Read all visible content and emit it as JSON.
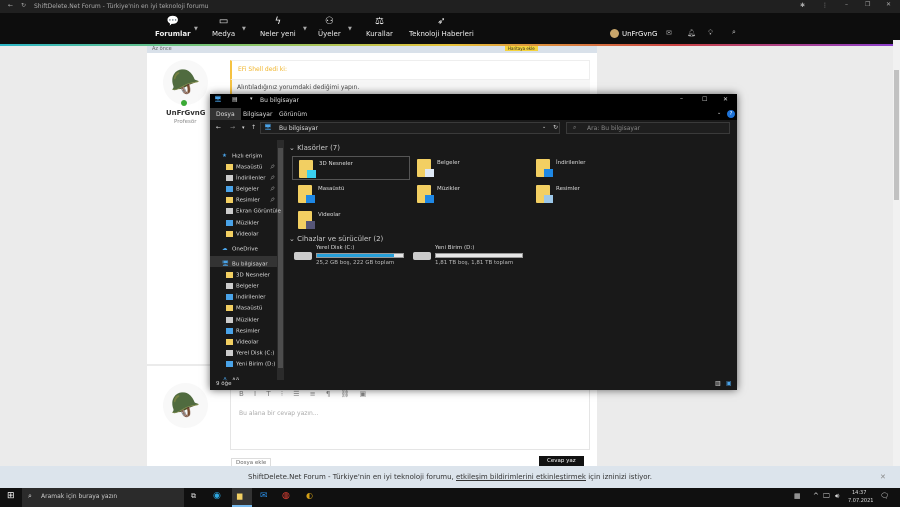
{
  "browser": {
    "title": "ShiftDelete.Net Forum - Türkiye'nin en iyi teknoloji forumu"
  },
  "nav": {
    "items": [
      {
        "label": "Forumlar",
        "icon": "chat-icon"
      },
      {
        "label": "Medya",
        "icon": "video-icon"
      },
      {
        "label": "Neler yeni",
        "icon": "bolt-icon"
      },
      {
        "label": "Üyeler",
        "icon": "users-icon"
      },
      {
        "label": "Kurallar",
        "icon": "scale-icon"
      },
      {
        "label": "Teknoloji Haberleri",
        "icon": "rocket-icon"
      }
    ],
    "user": "UnFrGvnG"
  },
  "post": {
    "time": "Az önce",
    "badge": "Haritaya ekle",
    "quote_author": "EFi Shell dedi ki:",
    "quote_text": "Alıntıladığınız yorumdaki dediğimi yapın.",
    "user": "UnFrGvnG",
    "rank": "Profesör"
  },
  "reply": {
    "placeholder": "Bu alana bir cevap yazın...",
    "attach": "Dosya ekle",
    "submit": "Cevap yaz"
  },
  "explorer": {
    "title": "Bu bilgisayar",
    "tabs": [
      "Dosya",
      "Bilgisayar",
      "Görünüm"
    ],
    "address": "Bu bilgisayar",
    "search_placeholder": "Ara: Bu bilgisayar",
    "sidebar": [
      "Hızlı erişim",
      "Masaüstü",
      "İndirilenler",
      "Belgeler",
      "Resimler",
      "Ekran Görüntüle",
      "Müzikler",
      "Videolar",
      "OneDrive",
      "Bu bilgisayar",
      "3D Nesneler",
      "Belgeler",
      "İndirilenler",
      "Masaüstü",
      "Müzikler",
      "Resimler",
      "Videolar",
      "Yerel Disk (C:)",
      "Yeni Birim (D:)",
      "Ağ"
    ],
    "folders_header": "Klasörler (7)",
    "folders": [
      "3D Nesneler",
      "Belgeler",
      "İndirilenler",
      "Masaüstü",
      "Müzikler",
      "Resimler",
      "Videolar"
    ],
    "drives_header": "Cihazlar ve sürücüler (2)",
    "drives": [
      {
        "name": "Yerel Disk (C:)",
        "info": "25,2 GB boş, 222 GB toplam",
        "used_fraction": 0.89
      },
      {
        "name": "Yeni Birim (D:)",
        "info": "1,81 TB boş, 1,81 TB toplam",
        "used_fraction": 0.0
      }
    ],
    "status": "9 öğe"
  },
  "notification": {
    "pre": "ShiftDelete.Net Forum - Türkiye'nin en iyi teknoloji forumu, ",
    "link": "etkileşim bildirimlerini etkinleştirmek",
    "post": " için izninizi istiyor."
  },
  "taskbar": {
    "search": "Aramak için buraya yazın",
    "time": "14:37",
    "date": "7.07.2021"
  }
}
